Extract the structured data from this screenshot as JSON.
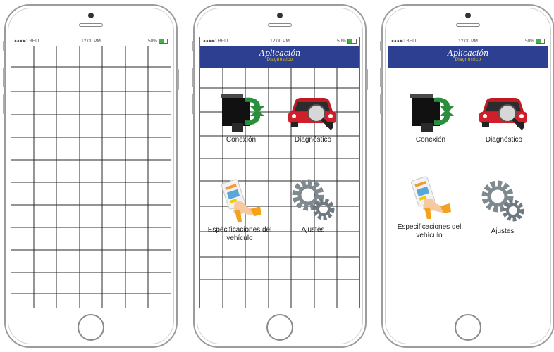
{
  "status_bar": {
    "carrier": "●●●●○ BELL",
    "time": "12:00 PM",
    "battery": "50%"
  },
  "app": {
    "title": "Aplicación",
    "subtitle": "Diagnóstico"
  },
  "menu": [
    {
      "label": "Conexión",
      "icon": "obd-connector-icon"
    },
    {
      "label": "Diagnóstico",
      "icon": "car-magnifier-icon"
    },
    {
      "label": "Especificaciones del vehículo",
      "icon": "hand-phone-icon"
    },
    {
      "label": "Ajustes",
      "icon": "gears-icon"
    }
  ],
  "colors": {
    "header": "#2d3f91",
    "subtitle": "#f2c80f",
    "car": "#d01f2a",
    "arrow": "#2a8f3d",
    "gear": "#7f8a90"
  }
}
